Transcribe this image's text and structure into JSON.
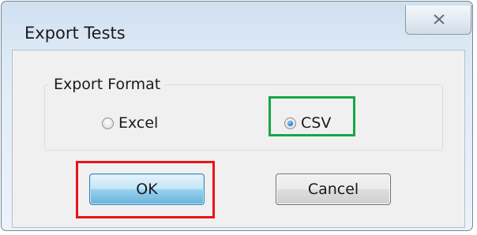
{
  "dialog": {
    "title": "Export Tests",
    "close_icon": "close-icon"
  },
  "export_format": {
    "legend": "Export Format",
    "options": [
      {
        "label": "Excel",
        "selected": false
      },
      {
        "label": "CSV",
        "selected": true
      }
    ]
  },
  "buttons": {
    "ok_label": "OK",
    "cancel_label": "Cancel"
  },
  "annotations": {
    "green_box_color": "#17a64a",
    "red_box_color": "#e8141b"
  }
}
